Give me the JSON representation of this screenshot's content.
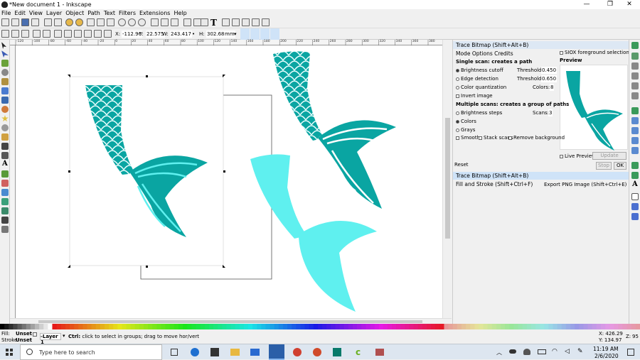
{
  "window": {
    "title": "*New document 1 - Inkscape"
  },
  "menu": [
    "File",
    "Edit",
    "View",
    "Layer",
    "Object",
    "Path",
    "Text",
    "Filters",
    "Extensions",
    "Help"
  ],
  "toolbar2": {
    "x_label": "X:",
    "x_value": "-112.96",
    "y_label": "Y:",
    "y_value": "22.575",
    "w_label": "W:",
    "w_value": "243.417",
    "h_label": "H:",
    "h_value": "302.683",
    "unit": "mm"
  },
  "dock": {
    "title": "Trace Bitmap (Shift+Alt+B)",
    "tabs": "Mode Options Credits",
    "siox": "SIOX foreground selection",
    "preview_label": "Preview",
    "single_scan": "Single scan: creates a path",
    "brightness_cutoff": "Brightness cutoff",
    "threshold_label": "Threshold:",
    "threshold_value": "0.450",
    "edge_detection": "Edge detection",
    "edge_threshold_value": "0.650",
    "color_quant": "Color quantization",
    "colors_label": "Colors:",
    "colors_value": "8",
    "invert_image": "Invert image",
    "multi_scan": "Multiple scans: creates a group of paths",
    "brightness_steps": "Brightness steps",
    "scans_label": "Scans:",
    "scans_value": "3",
    "colors_opt": "Colors",
    "grays_opt": "Grays",
    "smooth": "Smooth",
    "stack_scans": "Stack scans",
    "remove_bg": "Remove background",
    "live_preview": "Live Preview",
    "update_btn": "Update",
    "reset_btn": "Reset",
    "stop_btn": "Stop",
    "ok_btn": "OK",
    "panel_trace": "Trace Bitmap (Shift+Alt+B)",
    "panel_fill": "Fill and Stroke (Shift+Ctrl+F)",
    "panel_export": "Export PNG Image (Shift+Ctrl+E)"
  },
  "status": {
    "fill_label": "Fill:",
    "fill_value": "Unset",
    "stroke_label": "Stroke:",
    "stroke_value": "Unset",
    "layer": "-Layer 1",
    "message_bold": "Ctrl:",
    "message": " click to select in groups; drag to move hor/vert",
    "x_coord": "X: 426.29",
    "y_coord": "Y: 134.97",
    "z_label": "Z:",
    "zoom": "95"
  },
  "ruler_labels": [
    "-120",
    "-100",
    "-80",
    "-60",
    "-40",
    "-20",
    "0",
    "20",
    "40",
    "60",
    "80",
    "100",
    "120",
    "140",
    "160",
    "180",
    "200",
    "220",
    "240",
    "260",
    "280",
    "300",
    "320",
    "340",
    "360",
    "380"
  ],
  "taskbar": {
    "search_placeholder": "Type here to search",
    "time": "11:19 AM",
    "date": "2/6/2020"
  },
  "colors": {
    "teal_dark": "#0aa5a2",
    "teal_light": "#5ff0ef",
    "accent_blue": "#cfe3f8",
    "highlight": "#cfe3f8"
  }
}
